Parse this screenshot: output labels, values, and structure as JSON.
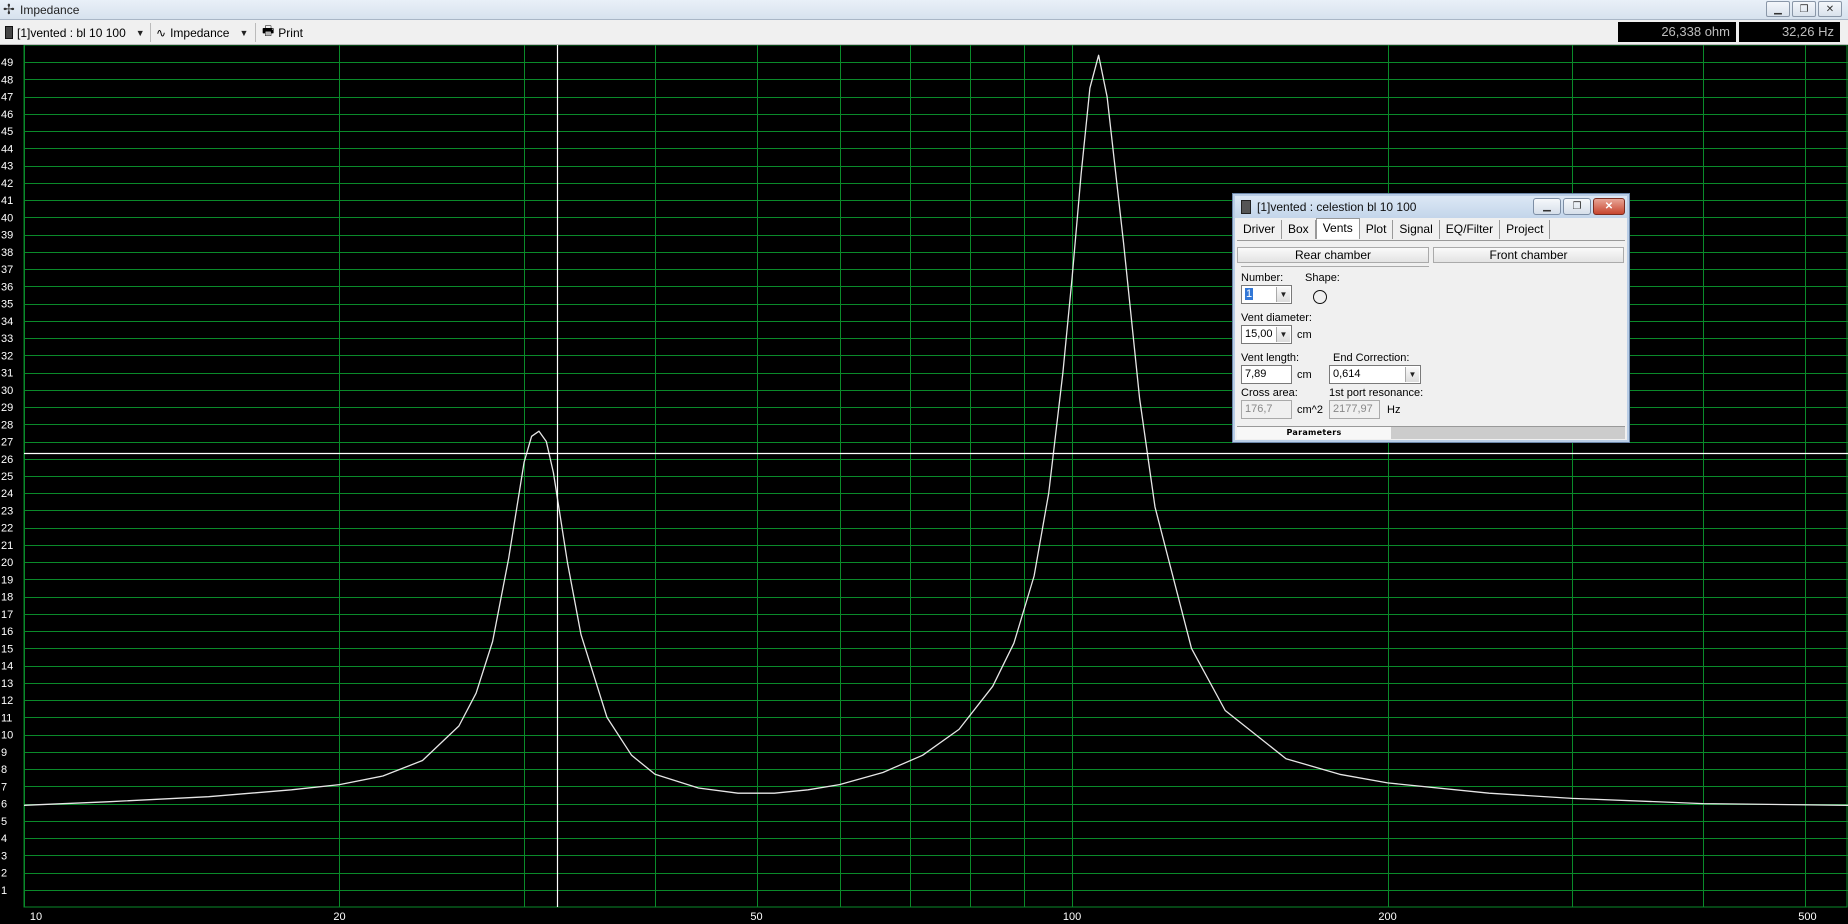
{
  "window": {
    "title": "Impedance",
    "controls": [
      "minimize-icon",
      "restore-icon",
      "close-icon"
    ]
  },
  "toolbar": {
    "project_selector": "[1]vented : bl 10 100",
    "graph_selector": "Impedance",
    "print_label": "Print",
    "readout_ohm": "26,338 ohm",
    "readout_hz": "32,26 Hz"
  },
  "chart_data": {
    "type": "line",
    "x_scale": "log",
    "xlim": [
      10,
      550
    ],
    "ylim": [
      0,
      50
    ],
    "x_ticks": [
      "10",
      "20",
      "50",
      "100",
      "200",
      "500"
    ],
    "y_ticks": [
      "1",
      "2",
      "3",
      "4",
      "5",
      "6",
      "7",
      "8",
      "9",
      "10",
      "11",
      "12",
      "13",
      "14",
      "15",
      "16",
      "17",
      "18",
      "19",
      "20",
      "21",
      "22",
      "23",
      "24",
      "25",
      "26",
      "27",
      "28",
      "29",
      "30",
      "31",
      "32",
      "33",
      "34",
      "35",
      "36",
      "37",
      "38",
      "39",
      "40",
      "41",
      "42",
      "43",
      "44",
      "45",
      "46",
      "47",
      "48",
      "49"
    ],
    "grid": true,
    "line_color": "#e6e6e6",
    "grid_color": "#0a8a2a",
    "cursor": {
      "x": 32.26,
      "y": 26.338
    },
    "series": [
      {
        "x": [
          10,
          12,
          15,
          18,
          20,
          22,
          24,
          26,
          27,
          28,
          29,
          30,
          30.5,
          31,
          31.5,
          32,
          33,
          34,
          36,
          38,
          40,
          44,
          48,
          52,
          56,
          60,
          66,
          72,
          78,
          84,
          88,
          92,
          95,
          98,
          100,
          102,
          104,
          106,
          108,
          112,
          116,
          120,
          130,
          140,
          160,
          180,
          200,
          250,
          300,
          400,
          550
        ],
        "y": [
          5.9,
          6.1,
          6.4,
          6.8,
          7.1,
          7.6,
          8.5,
          10.5,
          12.4,
          15.4,
          20.2,
          25.8,
          27.3,
          27.6,
          27.0,
          25.2,
          20.0,
          15.8,
          11.0,
          8.8,
          7.7,
          6.9,
          6.6,
          6.6,
          6.8,
          7.1,
          7.8,
          8.8,
          10.3,
          12.8,
          15.3,
          19.2,
          24.0,
          31.0,
          36.5,
          42.5,
          47.5,
          49.4,
          47.0,
          38.5,
          29.5,
          23.2,
          15.0,
          11.4,
          8.6,
          7.7,
          7.2,
          6.6,
          6.3,
          6.0,
          5.9
        ]
      }
    ]
  },
  "dialog": {
    "title": "[1]vented : celestion bl 10 100",
    "tabs": [
      "Driver",
      "Box",
      "Vents",
      "Plot",
      "Signal",
      "EQ/Filter",
      "Project"
    ],
    "active_tab": "Vents",
    "rear_chamber_label": "Rear chamber",
    "front_chamber_label": "Front chamber",
    "number_label": "Number:",
    "number_value": "1",
    "shape_label": "Shape:",
    "shape_icon": "circle-shape-icon",
    "vent_diameter_label": "Vent diameter:",
    "vent_diameter_value": "15,00",
    "vent_diameter_unit": "cm",
    "vent_length_label": "Vent length:",
    "vent_length_value": "7,89",
    "vent_length_unit": "cm",
    "end_correction_label": "End Correction:",
    "end_correction_value": "0,614",
    "cross_area_label": "Cross area:",
    "cross_area_value": "176,7",
    "cross_area_unit": "cm^2",
    "port_resonance_label": "1st port resonance:",
    "port_resonance_value": "2177,97",
    "port_resonance_unit": "Hz",
    "bottom_tab": "Parameters"
  }
}
